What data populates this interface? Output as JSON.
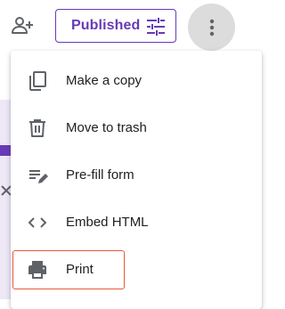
{
  "toolbar": {
    "add_collaborator_icon": "person-add-icon",
    "published_label": "Published",
    "published_icon": "tune-icon",
    "more_icon": "more-vert-icon"
  },
  "menu": {
    "items": [
      {
        "label": "Make a copy",
        "icon": "copy-icon"
      },
      {
        "label": "Move to trash",
        "icon": "trash-icon"
      },
      {
        "label": "Pre-fill form",
        "icon": "prefill-icon"
      },
      {
        "label": "Embed HTML",
        "icon": "code-icon"
      },
      {
        "label": "Print",
        "icon": "print-icon",
        "highlighted": true
      }
    ]
  },
  "colors": {
    "accent": "#673ab7",
    "highlight_border": "#e8593c",
    "more_button_bg": "#dcdcdc",
    "icon": "#5f6368"
  }
}
